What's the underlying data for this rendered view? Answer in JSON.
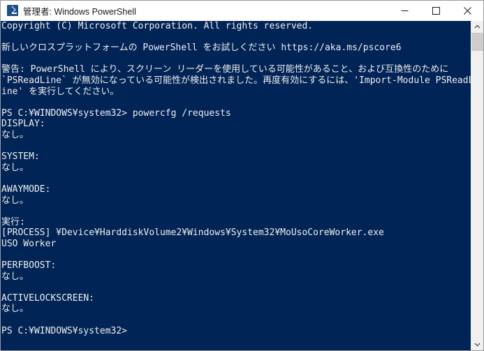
{
  "window": {
    "title": "管理者: Windows PowerShell",
    "icon": "powershell-prompt-icon",
    "background_color": "#012456",
    "text_color": "#eeeeee",
    "titlebar_background": "#ffffff",
    "controls": {
      "minimize": "minimize-button",
      "maximize": "maximize-button",
      "close": "close-button"
    }
  },
  "console": {
    "prompt": "PS C:¥WINDOWS¥system32>",
    "command": "powercfg /requests",
    "lines": [
      "Copyright (C) Microsoft Corporation. All rights reserved.",
      "",
      "新しいクロスプラットフォームの PowerShell をお試しください https://aka.ms/pscore6",
      "",
      "警告: PowerShell により、スクリーン リーダーを使用している可能性があること、および互換性のために",
      "`PSReadLine` が無効になっている可能性が検出されました。再度有効にするには、'Import-Module PSReadL",
      "ine' を実行してください。",
      "",
      "PS C:¥WINDOWS¥system32> powercfg /requests",
      "DISPLAY:",
      "なし。",
      "",
      "SYSTEM:",
      "なし。",
      "",
      "AWAYMODE:",
      "なし。",
      "",
      "実行:",
      "[PROCESS] ¥Device¥HarddiskVolume2¥Windows¥System32¥MoUsoCoreWorker.exe",
      "USO Worker",
      "",
      "PERFBOOST:",
      "なし。",
      "",
      "ACTIVELOCKSCREEN:",
      "なし。",
      "",
      "PS C:¥WINDOWS¥system32>"
    ],
    "sections": [
      {
        "name": "DISPLAY",
        "value": "なし。"
      },
      {
        "name": "SYSTEM",
        "value": "なし。"
      },
      {
        "name": "AWAYMODE",
        "value": "なし。"
      },
      {
        "name": "実行",
        "value": "[PROCESS] ¥Device¥HarddiskVolume2¥Windows¥System32¥MoUsoCoreWorker.exe"
      },
      {
        "name": "PERFBOOST",
        "value": "なし。"
      },
      {
        "name": "ACTIVELOCKSCREEN",
        "value": "なし。"
      }
    ]
  },
  "scrollbar": {
    "up_arrow": "▲",
    "down_arrow": "▼",
    "thumb_position_percent": 2
  }
}
